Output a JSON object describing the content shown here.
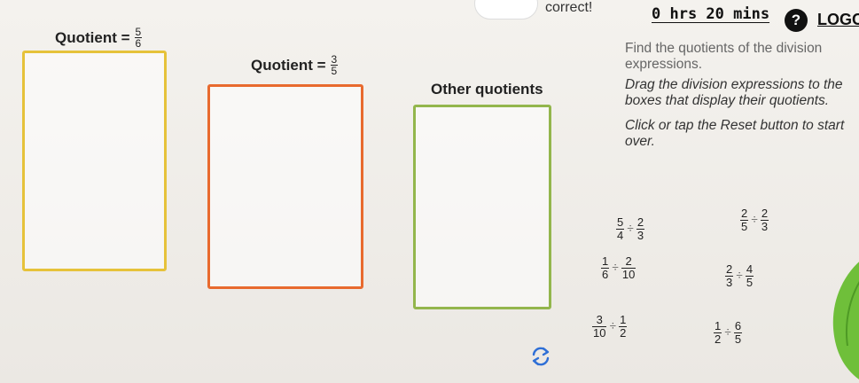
{
  "top": {
    "status_text": "correct!",
    "timer": "0 hrs 20 mins",
    "help_symbol": "?",
    "logo": "LOGO"
  },
  "bins": [
    {
      "label": "Quotient =",
      "num": "5",
      "den": "6",
      "color": "#e6c23a"
    },
    {
      "label": "Quotient =",
      "num": "3",
      "den": "5",
      "color": "#e86a2e"
    },
    {
      "label": "Other quotients",
      "color": "#93b64c"
    }
  ],
  "instructions": {
    "faded": "Find the quotients of the division expressions.",
    "main": "Drag the division expressions to the boxes that display their quotients.",
    "reset": "Click or tap the Reset button to start over."
  },
  "expressions": [
    {
      "a_num": "5",
      "a_den": "4",
      "op": "÷",
      "b_num": "2",
      "b_den": "3"
    },
    {
      "a_num": "2",
      "a_den": "5",
      "op": "÷",
      "b_num": "2",
      "b_den": "3"
    },
    {
      "a_num": "1",
      "a_den": "6",
      "op": "÷",
      "b_num": "2",
      "b_den": "10"
    },
    {
      "a_num": "2",
      "a_den": "3",
      "op": "÷",
      "b_num": "4",
      "b_den": "5"
    },
    {
      "a_num": "3",
      "a_den": "10",
      "op": "÷",
      "b_num": "1",
      "b_den": "2"
    },
    {
      "a_num": "1",
      "a_den": "2",
      "op": "÷",
      "b_num": "6",
      "b_den": "5"
    }
  ],
  "icons": {
    "reset": "reset-icon",
    "help": "help-icon"
  }
}
